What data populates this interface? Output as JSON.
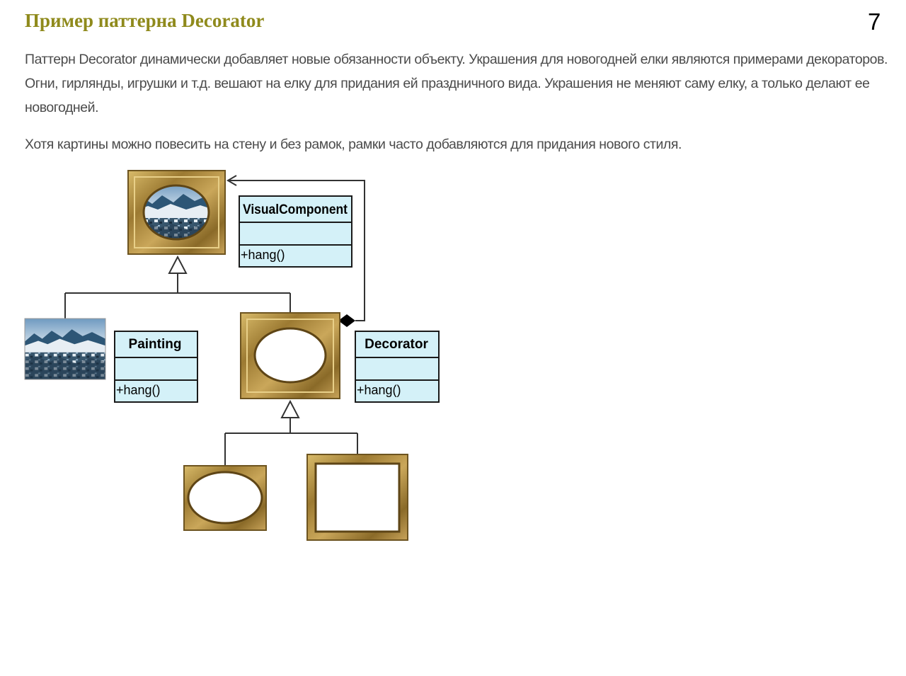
{
  "page": {
    "title": "Пример паттерна Decorator",
    "page_number": "7",
    "paragraphs": [
      "Паттерн Decorator динамически добавляет новые обязанности объекту. Украшения для новогодней елки являются примерами декораторов. Огни, гирлянды, игрушки и т.д. вешают на елку для придания ей праздничного вида. Украшения не меняют саму елку, а только делают ее новогодней.",
      "Хотя картины можно повесить на стену и без рамок, рамки часто добавляются для придания нового стиля."
    ]
  },
  "diagram": {
    "classes": {
      "visual_component": {
        "name": "VisualComponent",
        "operation": "+hang()"
      },
      "painting": {
        "name": "Painting",
        "operation": "+hang()"
      },
      "decorator": {
        "name": "Decorator",
        "operation": "+hang()"
      }
    },
    "colors": {
      "class_fill": "#d4f1f8",
      "class_border": "#1a1a1a",
      "frame_gold": "#b4923f",
      "title_color": "#8f8a1c"
    },
    "illustrations": [
      "framed-painting-image",
      "painting-image",
      "oval-frame-image",
      "small-oval-frame-image",
      "rectangular-frame-image"
    ]
  }
}
